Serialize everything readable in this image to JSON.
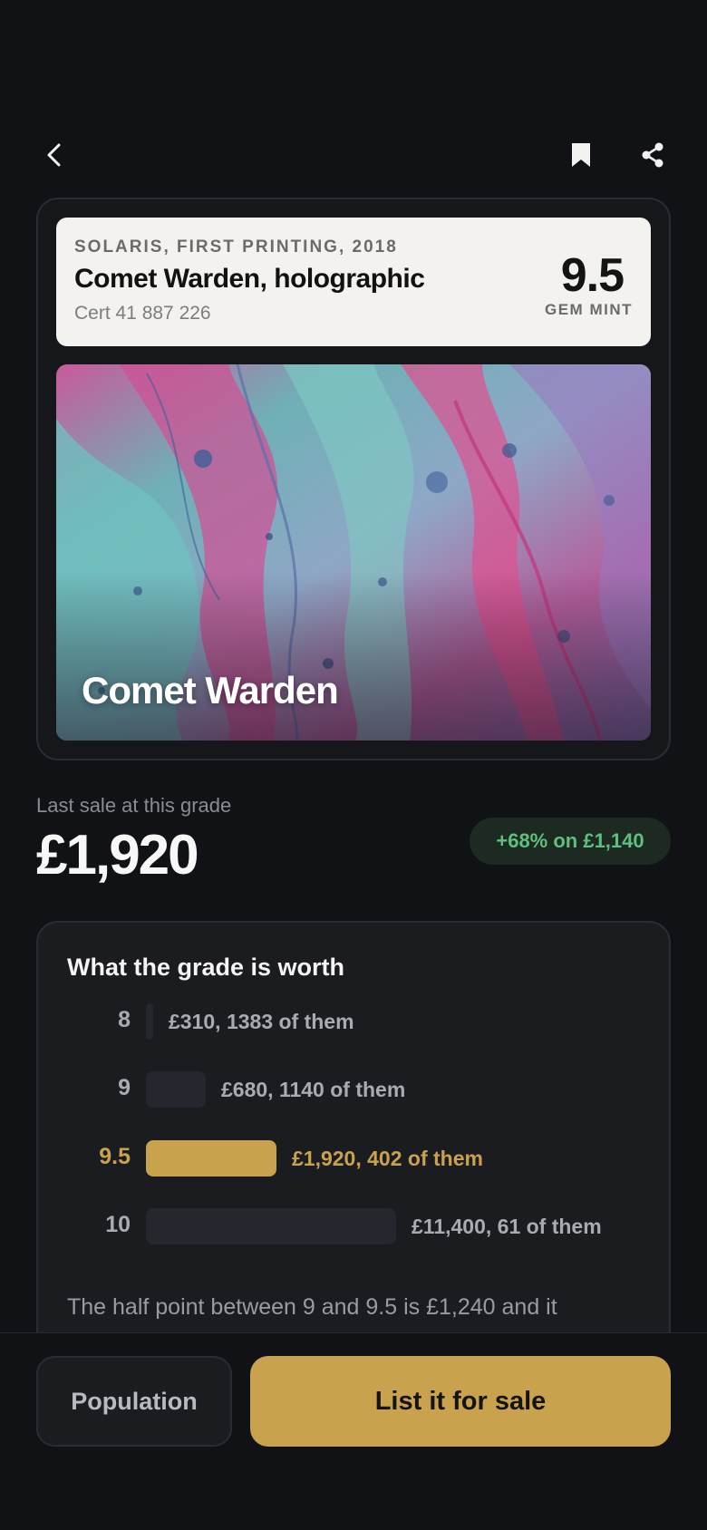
{
  "slab": {
    "set": "SOLARIS, FIRST PRINTING, 2018",
    "name": "Comet Warden, holographic",
    "cert": "Cert 41 887 226",
    "grade": "9.5",
    "grade_label": "GEM MINT"
  },
  "card": {
    "art_title": "Comet Warden"
  },
  "sale": {
    "caption": "Last sale at this grade",
    "price": "£1,920",
    "change_badge": "+68% on £1,140"
  },
  "worth": {
    "title": "What the grade is worth",
    "grades": [
      {
        "grade": "8",
        "value": "£310, 1383 of them",
        "price": 310
      },
      {
        "grade": "9",
        "value": "£680, 1140 of them",
        "price": 680
      },
      {
        "grade": "9.5",
        "value": "£1,920, 402 of them",
        "price": 1920,
        "active": true
      },
      {
        "grade": "10",
        "value": "£11,400, 61 of them",
        "price": 11400
      }
    ],
    "note": "The half point between 9 and 9.5 is £1,240 and it"
  },
  "actions": {
    "population_label": "Population",
    "list_label": "List it for sale"
  },
  "icons": {
    "back": "chevron-left-icon",
    "bookmark": "bookmark-icon",
    "share": "share-icon"
  },
  "colors": {
    "accent_gold": "#c9a24e",
    "positive_green": "#5fbf7e",
    "background": "#111215"
  }
}
